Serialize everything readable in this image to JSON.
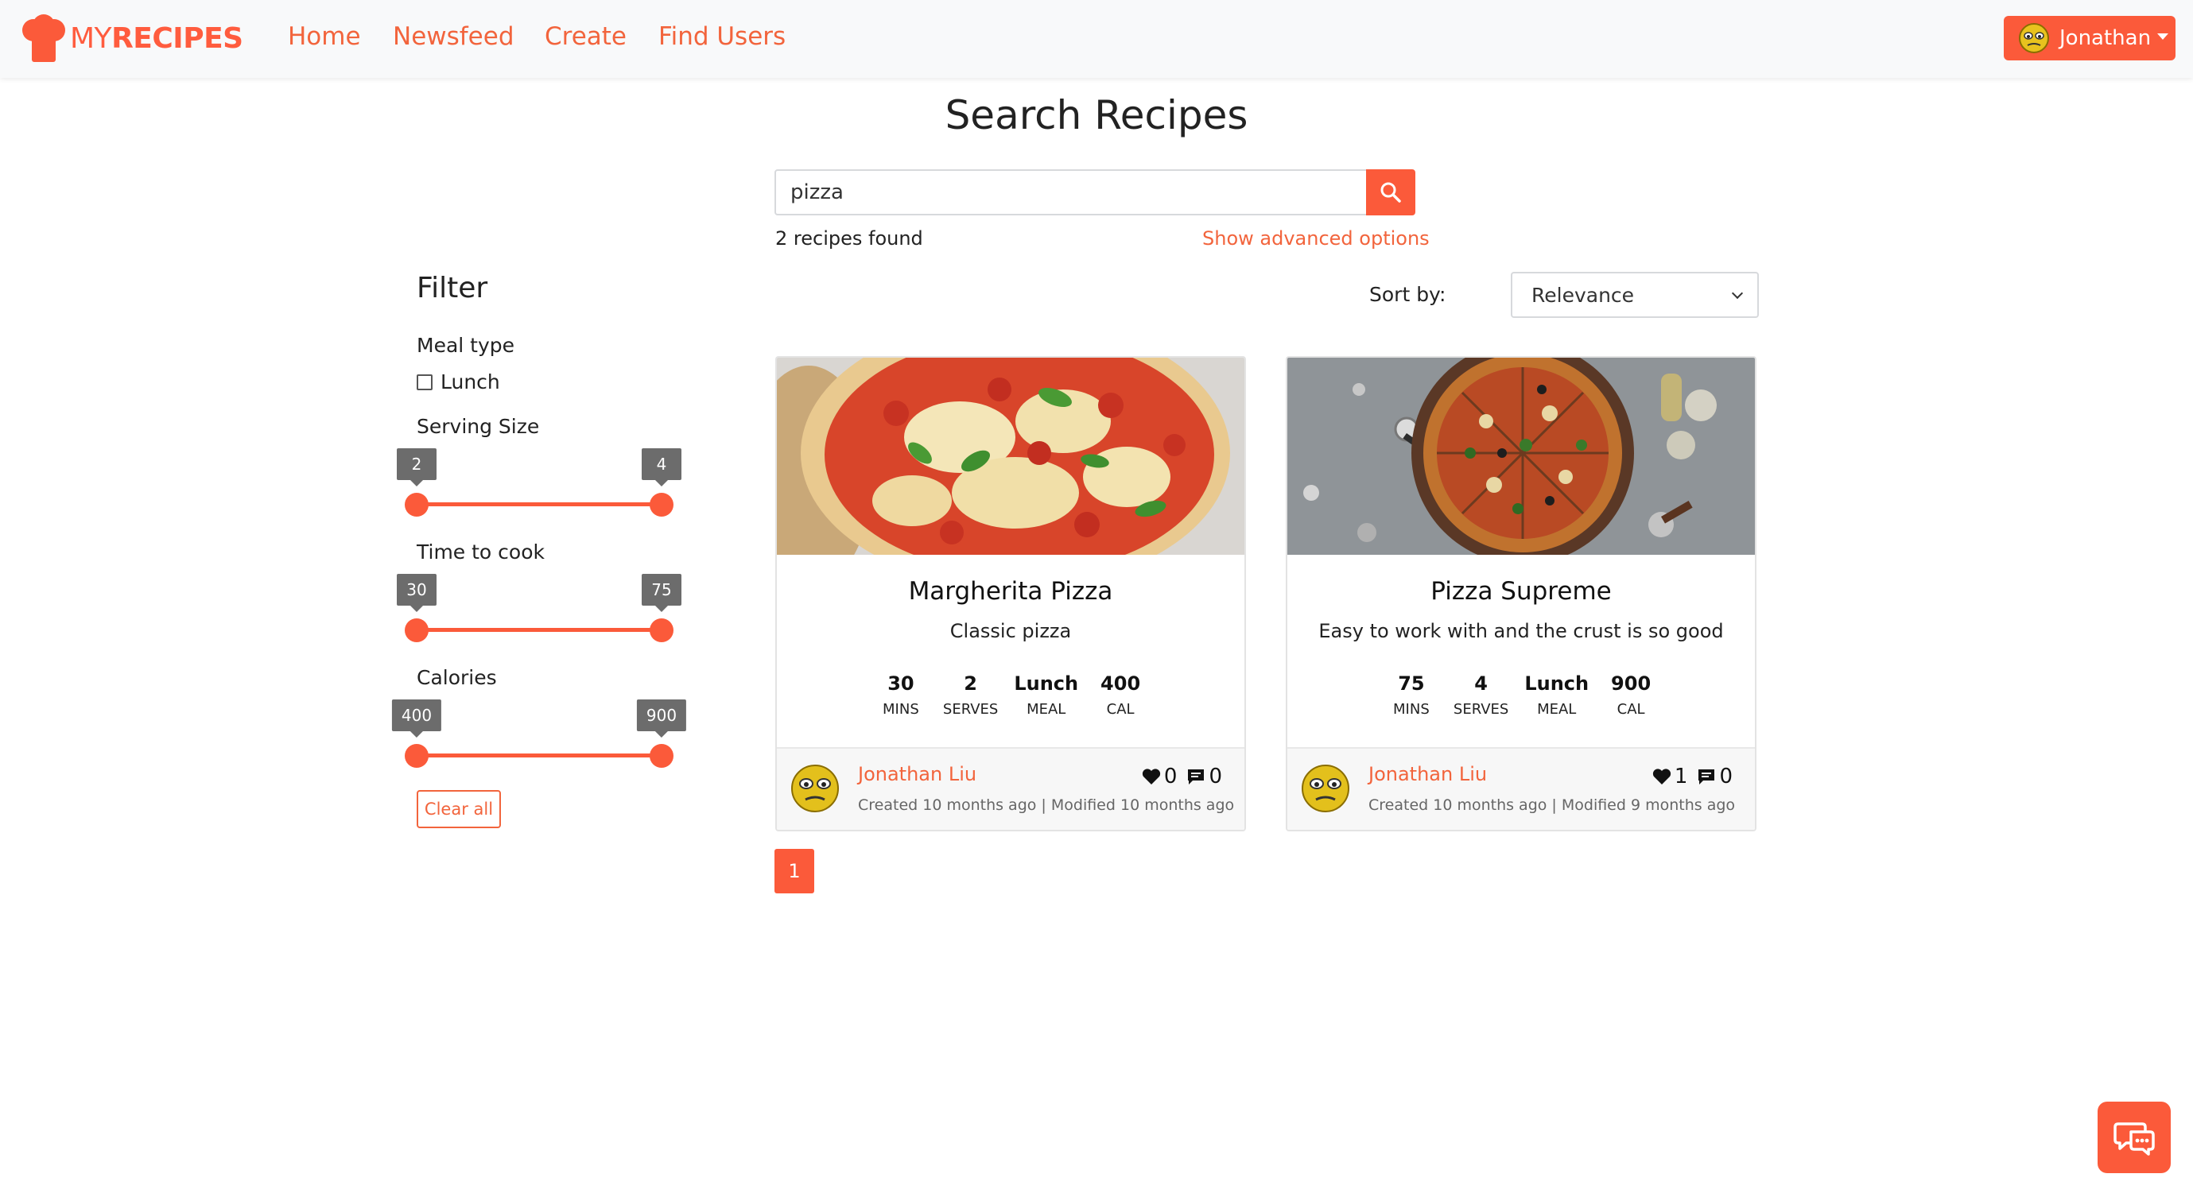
{
  "brand": {
    "prefix": "MY",
    "name": "RECIPES"
  },
  "nav": {
    "links": [
      "Home",
      "Newsfeed",
      "Create",
      "Find Users"
    ],
    "user": "Jonathan"
  },
  "page": {
    "title": "Search Recipes"
  },
  "search": {
    "value": "pizza",
    "results": "2 recipes found",
    "advanced": "Show advanced options"
  },
  "filter": {
    "title": "Filter",
    "meal_type_label": "Meal type",
    "meal_option": "Lunch",
    "serving_label": "Serving Size",
    "serving_min": "2",
    "serving_max": "4",
    "time_label": "Time to cook",
    "time_min": "30",
    "time_max": "75",
    "calories_label": "Calories",
    "calories_min": "400",
    "calories_max": "900",
    "clear": "Clear all"
  },
  "sort": {
    "label": "Sort by:",
    "selected": "Relevance"
  },
  "recipes": [
    {
      "title": "Margherita Pizza",
      "desc": "Classic pizza",
      "mins": "30",
      "serves": "2",
      "meal": "Lunch",
      "cal": "400",
      "author": "Jonathan Liu",
      "meta": "Created 10 months ago | Modified 10 months ago",
      "likes": "0",
      "comments": "0"
    },
    {
      "title": "Pizza Supreme",
      "desc": "Easy to work with and the crust is so good",
      "mins": "75",
      "serves": "4",
      "meal": "Lunch",
      "cal": "900",
      "author": "Jonathan Liu",
      "meta": "Created 10 months ago | Modified 9 months ago",
      "likes": "1",
      "comments": "0"
    }
  ],
  "stat_units": {
    "mins": "MINS",
    "serves": "SERVES",
    "meal": "MEAL",
    "cal": "CAL"
  },
  "pagination": {
    "current": "1"
  },
  "colors": {
    "accent": "#fb5a3a",
    "link": "#f2643c"
  }
}
